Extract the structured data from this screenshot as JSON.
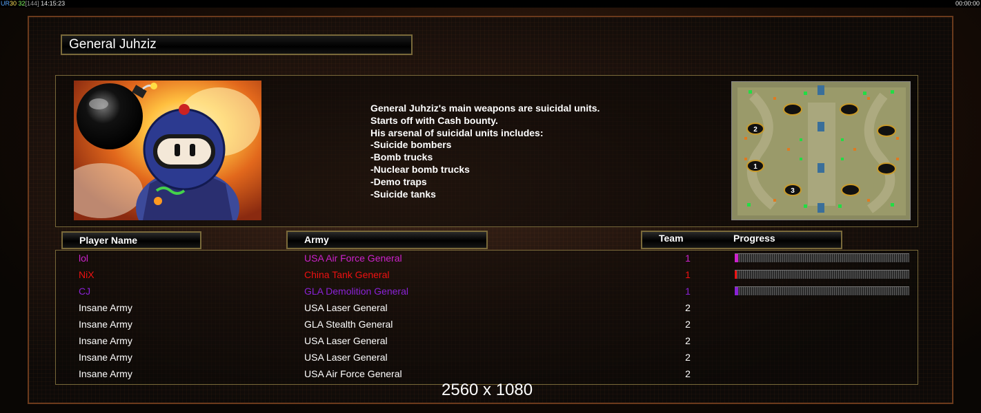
{
  "status_bar": {
    "ur_label": "UR",
    "fps_a": "30",
    "fps_b": "32",
    "fps_cap": "[144]",
    "clock": "14:15:23",
    "timer": "00:00:00"
  },
  "general": {
    "title": "General Juhziz",
    "description": [
      "General Juhziz's main weapons are suicidal units.",
      "Starts off with Cash bounty.",
      "His arsenal of suicidal units includes:",
      "-Suicide bombers",
      "-Bomb trucks",
      "-Nuclear bomb trucks",
      "-Demo traps",
      "-Suicide tanks"
    ]
  },
  "minimap": {
    "start_labels": [
      "2",
      "1",
      "3"
    ]
  },
  "table": {
    "headers": {
      "player_name": "Player Name",
      "army": "Army",
      "team": "Team",
      "progress": "Progress"
    },
    "rows": [
      {
        "name": "lol",
        "army": "USA Air Force General",
        "team": "1",
        "color": "#cc22cc",
        "progress": 0.02
      },
      {
        "name": "NiX",
        "army": "China Tank General",
        "team": "1",
        "color": "#ee1111",
        "progress": 0.01
      },
      {
        "name": "CJ",
        "army": "GLA Demolition General",
        "team": "1",
        "color": "#8a22d6",
        "progress": 0.02
      },
      {
        "name": "Insane Army",
        "army": "USA Laser General",
        "team": "2",
        "color": "#ffffff",
        "progress": null
      },
      {
        "name": "Insane Army",
        "army": "GLA Stealth General",
        "team": "2",
        "color": "#ffffff",
        "progress": null
      },
      {
        "name": "Insane Army",
        "army": "USA Laser General",
        "team": "2",
        "color": "#ffffff",
        "progress": null
      },
      {
        "name": "Insane Army",
        "army": "USA Laser General",
        "team": "2",
        "color": "#ffffff",
        "progress": null
      },
      {
        "name": "Insane Army",
        "army": "USA Air Force General",
        "team": "2",
        "color": "#ffffff",
        "progress": null
      }
    ]
  },
  "overlay_text": "2560 x 1080"
}
